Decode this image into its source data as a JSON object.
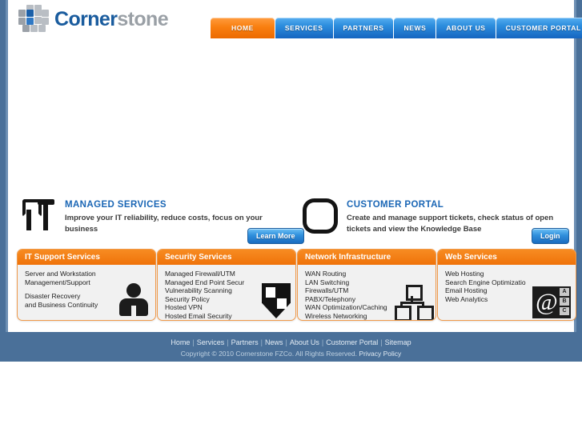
{
  "brand": {
    "name_part1": "Corner",
    "name_part2": "stone",
    "logo_icon": "cube-logo-icon"
  },
  "nav": {
    "items": [
      {
        "label": "HOME",
        "active": true
      },
      {
        "label": "SERVICES",
        "active": false
      },
      {
        "label": "PARTNERS",
        "active": false
      },
      {
        "label": "NEWS",
        "active": false
      },
      {
        "label": "ABOUT US",
        "active": false
      },
      {
        "label": "CUSTOMER PORTAL",
        "active": false
      }
    ]
  },
  "promos": [
    {
      "icon": "wrench-hammer-it-icon",
      "title": "MANAGED SERVICES",
      "description": "Improve your IT reliability, reduce costs, focus on your business",
      "button": "Learn More"
    },
    {
      "icon": "four-arrows-portal-icon",
      "title": "CUSTOMER PORTAL",
      "description": "Create and manage support tickets, check status of open tickets and view the Knowledge Base",
      "button": "Login"
    }
  ],
  "service_boxes": [
    {
      "title": "IT Support Services",
      "icon": "person-icon",
      "items": [
        "Server and Workstation",
        "Management/Support",
        "",
        "Disaster Recovery",
        "and Business Continuity"
      ]
    },
    {
      "title": "Security Services",
      "icon": "shield-icon",
      "items": [
        "Managed Firewall/UTM",
        "Managed End Point Secur",
        "Vulnerability Scanning",
        "Security Policy",
        "Hosted VPN",
        "Hosted Email Security"
      ]
    },
    {
      "title": "Network Infrastructure",
      "icon": "network-diagram-icon",
      "items": [
        "WAN Routing",
        "LAN Switching",
        "Firewalls/UTM",
        "PABX/Telephony",
        "WAN Optimization/Caching",
        "Wireless Networking"
      ]
    },
    {
      "title": "Web Services",
      "icon": "at-sign-icon",
      "items": [
        "Web Hosting",
        "Search Engine Optimizatio",
        "Email Hosting",
        "Web Analytics"
      ]
    }
  ],
  "footer": {
    "links": [
      "Home",
      "Services",
      "Partners",
      "News",
      "About Us",
      "Customer Portal",
      "Sitemap"
    ],
    "separator": "|",
    "copyright": "Copyright © 2010 Cornerstone FZCo. All Rights Reserved.",
    "privacy_link": "Privacy Policy"
  },
  "colors": {
    "brand_blue": "#1a5c9e",
    "accent_orange": "#ef7209",
    "footer_blue": "#4a7099",
    "nav_blue": "#2d8ede"
  }
}
